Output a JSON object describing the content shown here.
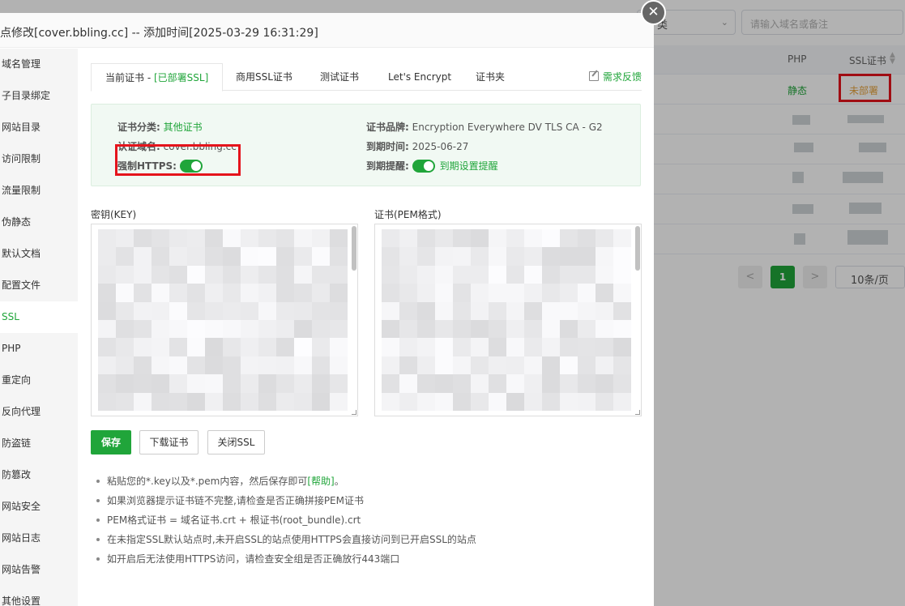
{
  "background": {
    "type_select": "类",
    "search_placeholder": "请输入域名或备注",
    "columns": {
      "php": "PHP",
      "ssl": "SSL证书"
    },
    "first_row": {
      "php": "静态",
      "ssl": "未部署"
    },
    "pagination": {
      "prev": "<",
      "current": "1",
      "next": ">",
      "page_size": "10条/页"
    }
  },
  "modal": {
    "title": "点修改[cover.bbling.cc] -- 添加时间[2025-03-29 16:31:29]",
    "close_label": "✕",
    "sidebar": [
      "域名管理",
      "子目录绑定",
      "网站目录",
      "访问限制",
      "流量限制",
      "伪静态",
      "默认文档",
      "配置文件",
      "SSL",
      "PHP",
      "重定向",
      "反向代理",
      "防盗链",
      "防篡改",
      "网站安全",
      "网站日志",
      "网站告警",
      "其他设置"
    ],
    "active_sidebar": "SSL",
    "tabs": {
      "current_prefix": "当前证书 - ",
      "current_status": "[已部署SSL]",
      "commercial": "商用SSL证书",
      "test": "测试证书",
      "letsencrypt": "Let's Encrypt",
      "folder": "证书夹",
      "feedback": "需求反馈"
    },
    "info": {
      "category_label": "证书分类:",
      "category_value": "其他证书",
      "domain_label": "认证域名:",
      "domain_value": "cover.bbling.cc",
      "force_https_label": "强制HTTPS:",
      "brand_label": "证书品牌:",
      "brand_value": "Encryption Everywhere DV TLS CA - G2",
      "expire_label": "到期时间:",
      "expire_value": "2025-06-27",
      "reminder_label": "到期提醒:",
      "reminder_value": "到期设置提醒"
    },
    "key_label": "密钥(KEY)",
    "cert_label": "证书(PEM格式)",
    "buttons": {
      "save": "保存",
      "download": "下载证书",
      "close_ssl": "关闭SSL"
    },
    "tips": {
      "tip1_text": "粘贴您的*.key以及*.pem内容，然后保存即可",
      "tip1_link": "[帮助]",
      "tip1_end": "。",
      "tip2": "如果浏览器提示证书链不完整,请检查是否正确拼接PEM证书",
      "tip3": "PEM格式证书 = 域名证书.crt + 根证书(root_bundle).crt",
      "tip4": "在未指定SSL默认站点时,未开启SSL的站点使用HTTPS会直接访问到已开启SSL的站点",
      "tip5": "如开启后无法使用HTTPS访问，请检查安全组是否正确放行443端口"
    }
  },
  "colors": {
    "accent": "#20a53a",
    "highlight": "#e5141c",
    "warning": "#e6a23c"
  }
}
